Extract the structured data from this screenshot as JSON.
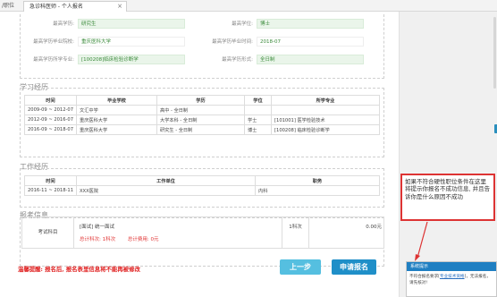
{
  "tabs": {
    "prev_label": "/职位",
    "active_label": "急诊科医师 - 个人报名",
    "close_glyph": "×"
  },
  "education_info": {
    "rows": [
      {
        "l1": "最高学历:",
        "v1": "研究生",
        "l2": "最高学位:",
        "v2": "博士"
      },
      {
        "l1": "最高学历毕业院校:",
        "v1": "重庆医科大学",
        "l2": "最高学历毕业时间:",
        "v2": "2018-07"
      },
      {
        "l1": "最高学历所学专业:",
        "v1": "[100208]临床检验诊断学",
        "l2": "最高学历形式:",
        "v2": "全日制"
      }
    ]
  },
  "study_history": {
    "title": "学习经历",
    "headers": [
      "时间",
      "毕业学校",
      "学历",
      "学位",
      "所学专业"
    ],
    "rows": [
      [
        "2009-09 ~ 2012-07",
        "文汇中学",
        "高中 - 全日制",
        "",
        ""
      ],
      [
        "2012-09 ~ 2016-07",
        "重庆医科大学",
        "大学本科 - 全日制",
        "学士",
        "[101001] 医学检验技术"
      ],
      [
        "2016-09 ~ 2018-07",
        "重庆医科大学",
        "研究生 - 全日制",
        "博士",
        "[100208] 临床检验诊断学"
      ]
    ]
  },
  "work_history": {
    "title": "工作经历",
    "headers": [
      "时间",
      "工作单位",
      "职务"
    ],
    "rows": [
      [
        "2016-11 ~ 2018-11",
        "XXX医院",
        "内科"
      ]
    ]
  },
  "exam_info": {
    "title": "报考信息",
    "label": "考试科目",
    "line1": "[面试] 统一面试",
    "total_subjects": "总计科次: 1科次",
    "total_fee": "总计费用: 0元",
    "qty": "1科次",
    "price": "0.00元"
  },
  "footer": {
    "warning": "温馨提醒: 报名后, 报名表里信息将不能再被修改",
    "prev_button": "上一步",
    "apply_button": "申请报名"
  },
  "annotation": {
    "text": "如果不符合硬性职位条件在这里将提示你报名不成功信息, 并且告诉你是什么原因不成功",
    "color": "#d33"
  },
  "toast": {
    "title": "系统提示",
    "body_prefix": "不符合报名要求[",
    "body_link": "专业技术资格",
    "body_suffix": "]，无法报名，请先核对!"
  },
  "colors": {
    "accent": "#1f8fc8",
    "secondary": "#55bfe0",
    "warning": "#e02020",
    "value_green": "#3a8a3a"
  }
}
